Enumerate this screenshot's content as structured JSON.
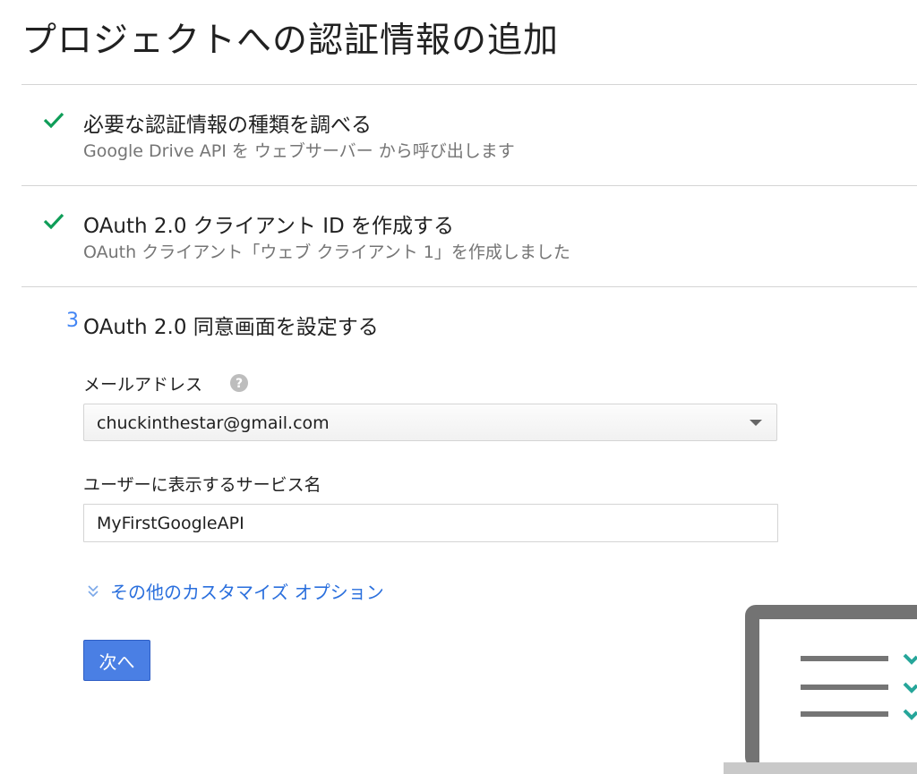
{
  "page": {
    "title": "プロジェクトへの認証情報の追加"
  },
  "steps": [
    {
      "status": "done",
      "icon": "check-icon",
      "title": "必要な認証情報の種類を調べる",
      "subtitle": "Google Drive API を ウェブサーバー から呼び出します"
    },
    {
      "status": "done",
      "icon": "check-icon",
      "title": "OAuth 2.0 クライアント ID を作成する",
      "subtitle": "OAuth クライアント「ウェブ クライアント 1」を作成しました"
    },
    {
      "status": "active",
      "number": "3",
      "title": "OAuth 2.0 同意画面を設定する"
    }
  ],
  "form": {
    "email": {
      "label": "メールアドレス",
      "value": "chuckinthestar@gmail.com",
      "icon": "help-icon"
    },
    "service_name": {
      "label": "ユーザーに表示するサービス名",
      "value": "MyFirstGoogleAPI"
    },
    "more_options": {
      "label": "その他のカスタマイズ オプション",
      "icon": "double-chevron-down-icon"
    },
    "next_label": "次へ"
  },
  "colors": {
    "check": "#0f9d58",
    "step_number": "#4285f4",
    "link": "#2a6fdd",
    "button": "#4a7fe4",
    "laptop_frame": "#737373",
    "checklist_tick": "#26a69a"
  }
}
